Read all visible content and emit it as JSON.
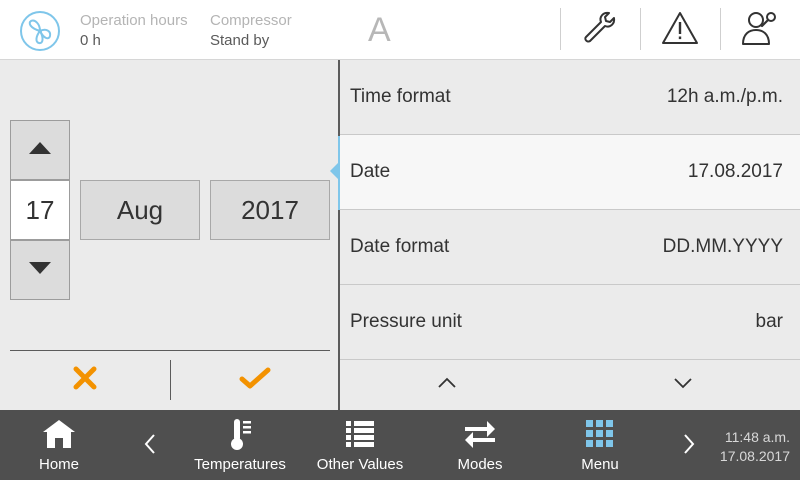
{
  "header": {
    "operation_hours_label": "Operation hours",
    "operation_hours_value": "0 h",
    "compressor_label": "Compressor",
    "compressor_value": "Stand by",
    "mode_letter": "A",
    "icons": [
      "fan-logo-icon",
      "wrench-icon",
      "warning-icon",
      "user-settings-icon"
    ]
  },
  "date_editor": {
    "day": "17",
    "month": "Aug",
    "year": "2017",
    "icons": [
      "arrow-up-icon",
      "arrow-down-icon",
      "cancel-icon",
      "confirm-icon"
    ]
  },
  "settings": [
    {
      "label": "Time format",
      "value": "12h a.m./p.m."
    },
    {
      "label": "Date",
      "value": "17.08.2017"
    },
    {
      "label": "Date format",
      "value": "DD.MM.YYYY"
    },
    {
      "label": "Pressure unit",
      "value": "bar"
    }
  ],
  "footer": {
    "nav": [
      {
        "label": "Home",
        "icon": "home-icon"
      },
      {
        "label": "Temperatures",
        "icon": "thermometer-icon"
      },
      {
        "label": "Other Values",
        "icon": "list-icon"
      },
      {
        "label": "Modes",
        "icon": "swap-arrows-icon"
      },
      {
        "label": "Menu",
        "icon": "grid-menu-icon"
      }
    ],
    "time": "11:48 a.m.",
    "date": "17.08.2017"
  },
  "colors": {
    "accent_orange": "#f39200",
    "accent_blue": "#7fc6ea",
    "footer_bg": "#4f4f4f",
    "menu_active": "#7fc6ea"
  }
}
